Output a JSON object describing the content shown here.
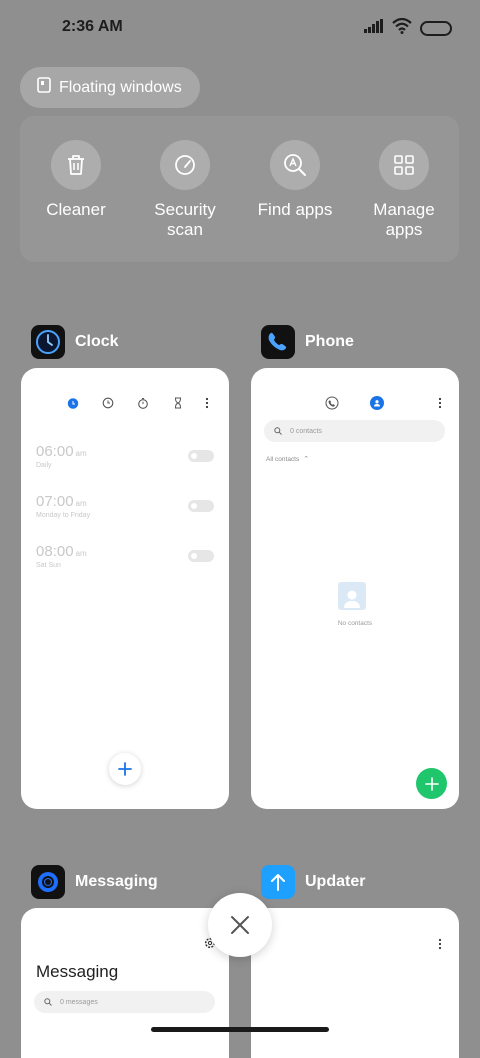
{
  "status_bar": {
    "time": "2:36 AM"
  },
  "floating_windows": {
    "label": "Floating windows"
  },
  "quick_actions": [
    {
      "label": "Cleaner",
      "icon": "trash-icon"
    },
    {
      "label": "Security scan",
      "icon": "speedometer-icon"
    },
    {
      "label": "Find apps",
      "icon": "search-app-icon"
    },
    {
      "label": "Manage apps",
      "icon": "grid-icon"
    }
  ],
  "recent_apps": {
    "clock": {
      "name": "Clock",
      "alarms": [
        {
          "time": "06:00",
          "ampm": "am",
          "repeat": "Daily"
        },
        {
          "time": "07:00",
          "ampm": "am",
          "repeat": "Monday to Friday"
        },
        {
          "time": "08:00",
          "ampm": "am",
          "repeat": "Sat Sun"
        }
      ]
    },
    "phone": {
      "name": "Phone",
      "search_placeholder": "0 contacts",
      "filter": "All contacts",
      "empty_text": "No contacts"
    },
    "messaging": {
      "name": "Messaging",
      "title": "Messaging",
      "search_placeholder": "0 messages"
    },
    "updater": {
      "name": "Updater"
    }
  },
  "colors": {
    "accent_blue": "#1a73e8",
    "fab_green": "#1fc66b",
    "background": "#8e8f8e"
  }
}
